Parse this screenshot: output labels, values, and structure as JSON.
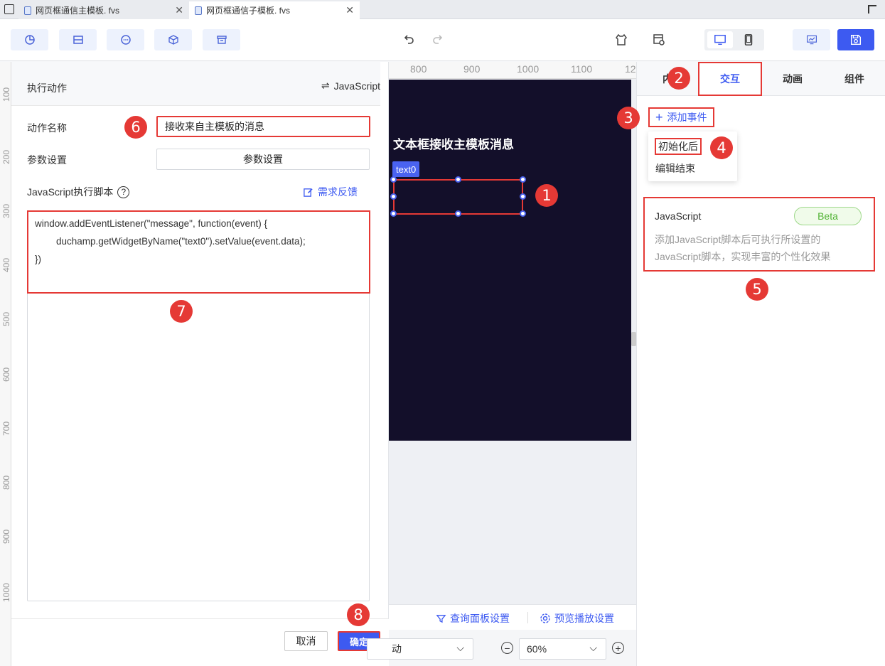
{
  "tabs": [
    {
      "label": "网页框通信主模板. fvs"
    },
    {
      "label": "网页框通信子模板. fvs"
    }
  ],
  "ruler_v": [
    "100",
    "200",
    "300",
    "400",
    "500",
    "600",
    "700",
    "800",
    "900",
    "1000"
  ],
  "ruler_h": [
    "800",
    "900",
    "1000",
    "1100",
    "12"
  ],
  "dialog": {
    "title": "执行动作",
    "switch_label": "JavaScript",
    "action_name_label": "动作名称",
    "action_name_value": "接收来自主模板的消息",
    "param_label": "参数设置",
    "param_button": "参数设置",
    "script_label": "JavaScript执行脚本",
    "help_icon": "?",
    "feedback_link": "需求反馈",
    "code": [
      "window.addEventListener(\"message\", function(event) {",
      "        duchamp.getWidgetByName(\"text0\").setValue(event.data);",
      "})"
    ],
    "cancel": "取消",
    "ok": "确定"
  },
  "canvas": {
    "title": "文本框接收主模板消息",
    "widget_tag": "text0",
    "query_panel": "查询面板设置",
    "preview_settings": "预览播放设置",
    "select_value": "动",
    "zoom_value": "60%"
  },
  "right_panel": {
    "tabs": [
      "内",
      "交互",
      "动画",
      "组件"
    ],
    "add_event": "添加事件",
    "menu_items": [
      "初始化后",
      "编辑结束"
    ],
    "js_card_title": "JavaScript",
    "beta": "Beta",
    "js_desc_1": "添加JavaScript脚本后可执行所设置的",
    "js_desc_2": "JavaScript脚本，实现丰富的个性化效果"
  },
  "markers": [
    "1",
    "2",
    "3",
    "4",
    "5",
    "6",
    "7",
    "8"
  ],
  "colors": {
    "accent": "#3d5af1",
    "marker": "#e53935",
    "artboard": "#130f2a"
  }
}
